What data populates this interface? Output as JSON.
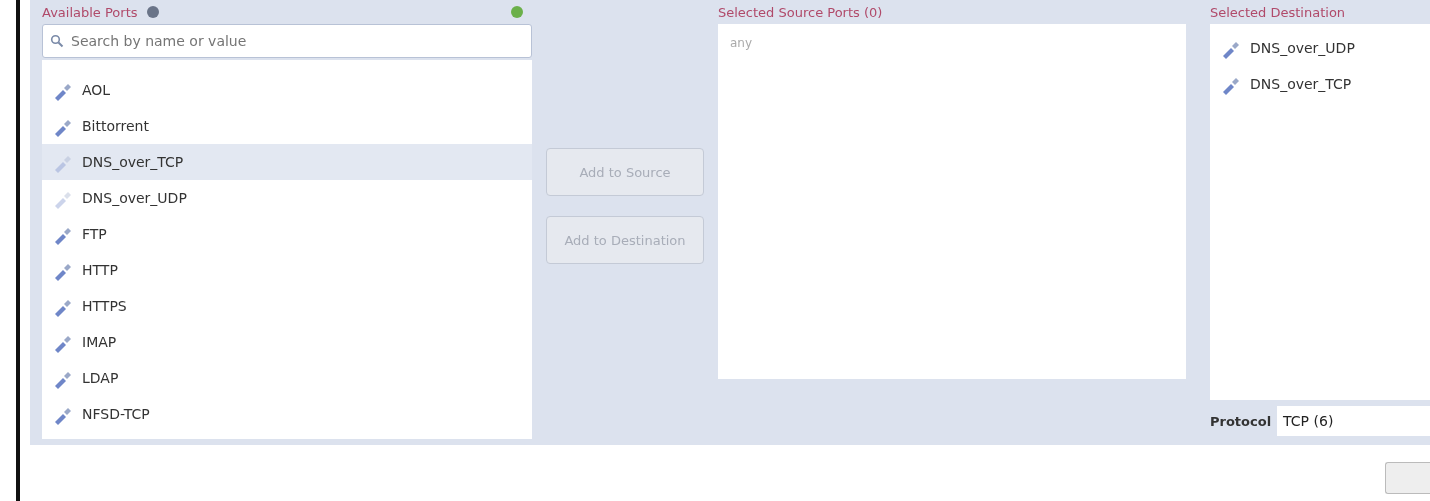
{
  "available_ports": {
    "heading": "Available Ports",
    "search": {
      "placeholder": "Search by name or value"
    },
    "items": [
      {
        "label": "AOL",
        "selected": false,
        "disabled": false
      },
      {
        "label": "Bittorrent",
        "selected": false,
        "disabled": false
      },
      {
        "label": "DNS_over_TCP",
        "selected": true,
        "disabled": true
      },
      {
        "label": "DNS_over_UDP",
        "selected": false,
        "disabled": true
      },
      {
        "label": "FTP",
        "selected": false,
        "disabled": false
      },
      {
        "label": "HTTP",
        "selected": false,
        "disabled": false
      },
      {
        "label": "HTTPS",
        "selected": false,
        "disabled": false
      },
      {
        "label": "IMAP",
        "selected": false,
        "disabled": false
      },
      {
        "label": "LDAP",
        "selected": false,
        "disabled": false
      },
      {
        "label": "NFSD-TCP",
        "selected": false,
        "disabled": false
      }
    ]
  },
  "buttons": [
    {
      "label": "Add to Source",
      "disabled": true
    },
    {
      "label": "Add to Destination",
      "disabled": true
    }
  ],
  "source_ports": {
    "heading": "Selected Source Ports (0)",
    "placeholder": "any"
  },
  "destination_ports": {
    "heading": "Selected Destination",
    "items": [
      {
        "label": "DNS_over_UDP"
      },
      {
        "label": "DNS_over_TCP"
      }
    ],
    "protocol": {
      "label": "Protocol",
      "value": "TCP (6)"
    }
  }
}
